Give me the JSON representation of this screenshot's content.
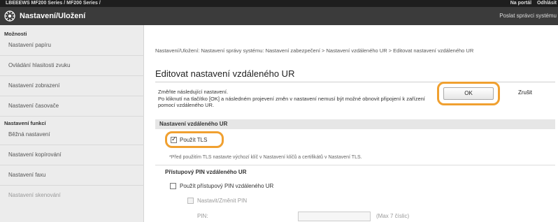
{
  "topbar": {
    "left_text": "LBEEEWS MF200 Series / MF200 Series /",
    "portal_link": "Na portál",
    "logout_link": "Odhlásit"
  },
  "header": {
    "title": "Nastavení/Uložení",
    "mail_link": "Poslat správci systému"
  },
  "sidebar": {
    "group1": "Možnosti",
    "items1": [
      "Nastavení papíru",
      "Ovládání hlasitosti zvuku",
      "Nastavení zobrazení",
      "Nastavení časovače"
    ],
    "group2": "Nastavení funkcí",
    "items2": [
      "Běžná nastavení",
      "Nastavení kopírování",
      "Nastavení faxu",
      "Nastavení skenování"
    ]
  },
  "main": {
    "breadcrumb": "Nastavení/Uložení: Nastavení správy systému: Nastavení zabezpečení > Nastavení vzdáleného UR > Editovat nastavení vzdáleného UR",
    "title": "Editovat nastavení vzdáleného UR",
    "note_line1": "Změňte následující nastavení.",
    "note_line2": "Po kliknutí na tlačítko [OK] a následném projevení změn v nastavení nemusí být možné obnovit připojení k zařízení pomocí vzdáleného UR.",
    "ok_label": "OK",
    "cancel_label": "Zrušit",
    "section_title": "Nastavení vzdáleného UR",
    "use_tls_label": "Použít TLS",
    "use_tls_checked": true,
    "tls_hint": "*Před použitím TLS nastavte výchozí klíč v Nastavení klíčů a certifikátů v Nastavení TLS.",
    "pin_section_title": "Přístupový PIN vzdáleného UR",
    "use_pin_label": "Použít přístupový PIN vzdáleného UR",
    "set_pin_label": "Nastavit/Změnit PIN",
    "pin_label": "PIN:",
    "pin_hint": "(Max 7 číslic)"
  },
  "colors": {
    "topbar": "#1e1e1e",
    "titlebar": "#3b3b3b",
    "highlight": "#f0a030",
    "sidebar": "#ececec"
  }
}
